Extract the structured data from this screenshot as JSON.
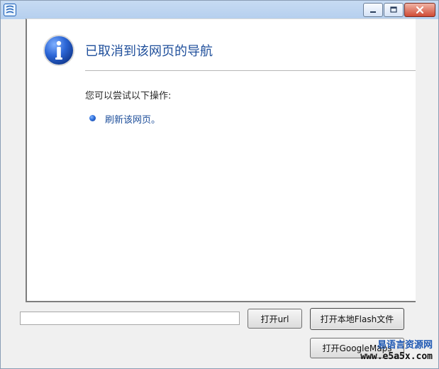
{
  "window": {
    "title": "",
    "controls": {
      "minimize_icon": "minimize-icon",
      "maximize_icon": "maximize-icon",
      "close_icon": "close-icon"
    }
  },
  "page": {
    "headline": "已取消到该网页的导航",
    "try_label": "您可以尝试以下操作:",
    "refresh_link": "刷新该网页。"
  },
  "controls": {
    "url_input": {
      "value": "",
      "placeholder": ""
    },
    "open_url_button": "打开url",
    "open_flash_button": "打开本地Flash文件",
    "open_maps_button": "打开GoogleMaps"
  },
  "watermark": {
    "line1": "易语言资源网",
    "line2": "www.e5a5x.com"
  },
  "colors": {
    "accent": "#1f4f9b",
    "link": "#1d4e9a",
    "title_bar": "#c7dbf3"
  }
}
